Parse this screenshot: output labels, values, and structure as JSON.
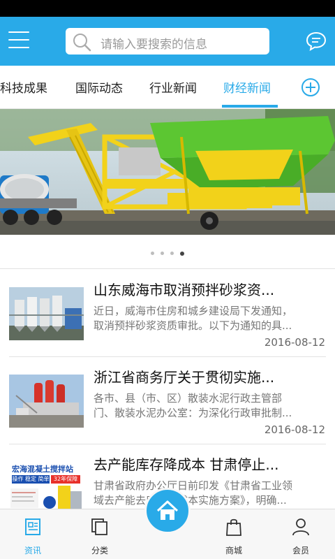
{
  "search": {
    "placeholder": "请输入要搜索的信息"
  },
  "tabs": [
    {
      "label": "科技成果"
    },
    {
      "label": "国际动态"
    },
    {
      "label": "行业新闻"
    },
    {
      "label": "财经新闻",
      "active": true
    }
  ],
  "banner": {
    "dot_count": 4,
    "active_dot": 4
  },
  "news": [
    {
      "title": "山东威海市取消预拌砂浆资...",
      "desc1": "近日，威海市住房和城乡建设局下发通知，",
      "desc2": "取消预拌砂浆资质审批。以下为通知的具...",
      "date": "2016-08-12"
    },
    {
      "title": "浙江省商务厅关于贯彻实施...",
      "desc1": "各市、县（市、区）散装水泥行政主管部",
      "desc2": "门、散装水泥办公室：为深化行政审批制...",
      "date": "2016-08-12"
    },
    {
      "title": "去产能库存降成本 甘肃停止...",
      "desc1": "甘肃省政府办公厅日前印发《甘肃省工业领",
      "desc2": "域去产能去库存降成本实施方案》，明确...",
      "date": "",
      "thumb_text": {
        "name": "宏海混凝土搅拌站",
        "slogan": "操作 稳定 简单",
        "badge": "32年保障"
      }
    }
  ],
  "bottom_nav": [
    {
      "label": "资讯",
      "active": true
    },
    {
      "label": "分类"
    },
    {
      "label": "商城"
    },
    {
      "label": "会员"
    }
  ],
  "colors": {
    "accent": "#29aae8",
    "banner_yellow": "#f2d21a",
    "banner_green": "#5cc632"
  },
  "icons": [
    "menu-icon",
    "search-icon",
    "message-icon",
    "add-icon",
    "news-icon",
    "category-icon",
    "home-icon",
    "shopping-bag-icon",
    "user-icon"
  ]
}
